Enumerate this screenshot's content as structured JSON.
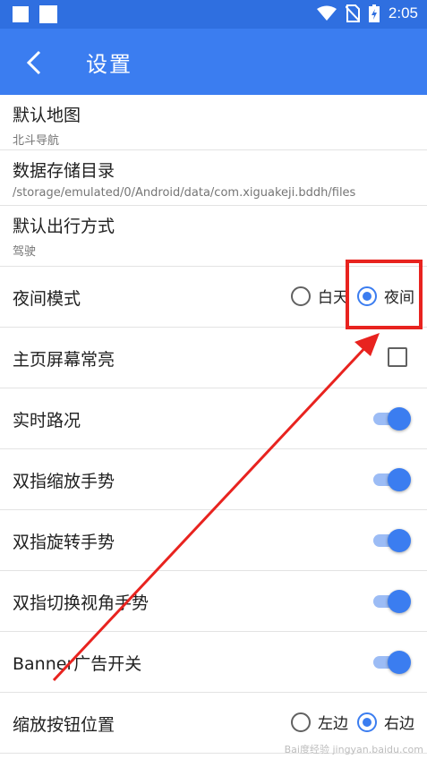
{
  "status_bar": {
    "time": "2:05"
  },
  "app_bar": {
    "title": "设置"
  },
  "settings": {
    "default_map": {
      "label": "默认地图",
      "value": "北斗导航"
    },
    "storage_dir": {
      "label": "数据存储目录",
      "value": "/storage/emulated/0/Android/data/com.xiguakeji.bddh/files"
    },
    "travel_mode": {
      "label": "默认出行方式",
      "value": "驾驶"
    },
    "night_mode": {
      "label": "夜间模式",
      "option_day": "白天",
      "option_night": "夜间",
      "selected": "夜间"
    },
    "keep_screen_on": {
      "label": "主页屏幕常亮",
      "checked": false
    },
    "traffic": {
      "label": "实时路况",
      "on": true
    },
    "pinch_zoom": {
      "label": "双指缩放手势",
      "on": true
    },
    "rotate": {
      "label": "双指旋转手势",
      "on": true
    },
    "tilt": {
      "label": "双指切换视角手势",
      "on": true
    },
    "banner_ads": {
      "label": "Banner广告开关",
      "on": true
    },
    "zoom_buttons": {
      "label": "缩放按钮位置",
      "option_left": "左边",
      "option_right": "右边",
      "selected": "右边"
    }
  },
  "annotation_color": "#e8231f",
  "watermark": "Bai度经验 jingyan.baidu.com"
}
